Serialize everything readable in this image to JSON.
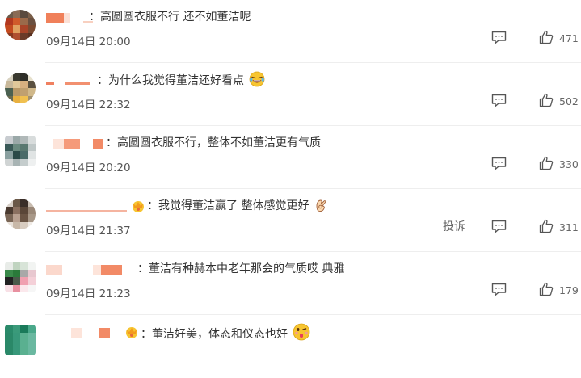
{
  "comments": [
    {
      "text": "高圆圆衣服不行 还不如董洁呢",
      "time": "09月14日 20:00",
      "likes": "471"
    },
    {
      "text": "为什么我觉得董洁还好看点",
      "time": "09月14日 22:32",
      "likes": "502"
    },
    {
      "text": "高圆圆衣服不行，整体不如董洁更有气质",
      "time": "09月14日 20:20",
      "likes": "330"
    },
    {
      "text": "我觉得董洁赢了 整体感觉更好",
      "time": "09月14日 21:37",
      "likes": "311",
      "report": "投诉"
    },
    {
      "text": "董洁有种赫本中老年那会的气质哎 典雅",
      "time": "09月14日 21:23",
      "likes": "179"
    },
    {
      "text": "董洁好美，体态和仪态也好"
    }
  ],
  "colors": {
    "text": "#333333",
    "meta": "#666666",
    "name_blur": "#f08a6a"
  },
  "icons": [
    "reply-icon",
    "like-icon",
    "laugh-emoji",
    "ok-hand-emoji",
    "crown-badge",
    "tongue-out-emoji"
  ]
}
